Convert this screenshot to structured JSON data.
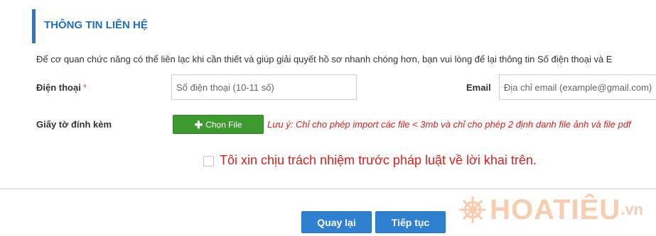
{
  "section": {
    "title": "THÔNG TIN LIÊN HỆ",
    "intro": "Để cơ quan chức năng có thể liên lạc khi cần thiết và giúp giải quyết hồ sơ nhanh chóng hơn, bạn vui lòng để lại thông tin Số điện thoại và E"
  },
  "phone": {
    "label": "Điện thoại",
    "required_mark": "*",
    "placeholder": "Số điện thoại (10-11 số)",
    "value": ""
  },
  "email": {
    "label": "Email",
    "placeholder": "Địa chỉ email (example@gmail.com)",
    "value": ""
  },
  "attachment": {
    "label": "Giấy tờ đính kèm",
    "button_label": "Chọn File",
    "button_icon": "plus-icon",
    "note": "Lưu ý: Chỉ cho phép import các file < 3mb và chỉ cho phép 2 định danh file ảnh và file pdf"
  },
  "commitment": {
    "checked": false,
    "text": "Tôi xin chịu trách nhiệm trước pháp luật về lời khai trên."
  },
  "actions": {
    "back_label": "Quay lại",
    "next_label": "Tiếp tục"
  },
  "watermark": {
    "text": "HOATIÊU",
    "suffix": ".vn",
    "icon": "ship-wheel-icon"
  },
  "colors": {
    "accent": "#2a77c9",
    "title": "#1f6fbf",
    "primary_button": "#2f80d0",
    "file_button": "#3c9a2f",
    "warning_text": "#d9201b",
    "required": "#d9534f",
    "watermark": "#f3a46f"
  }
}
